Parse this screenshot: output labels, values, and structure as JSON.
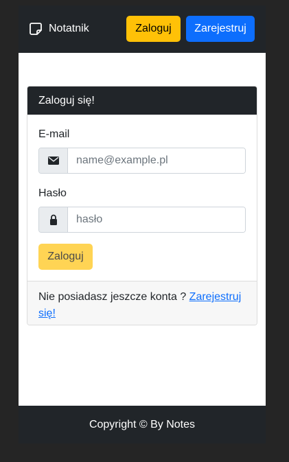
{
  "navbar": {
    "brand": {
      "icon": "note-icon",
      "label": "Notatnik"
    },
    "login_label": "Zaloguj",
    "register_label": "Zarejestruj"
  },
  "login_card": {
    "title": "Zaloguj się!",
    "email": {
      "label": "E-mail",
      "icon": "envelope-icon",
      "placeholder": "name@example.pl",
      "value": ""
    },
    "password": {
      "label": "Hasło",
      "icon": "lock-icon",
      "placeholder": "hasło",
      "value": ""
    },
    "submit_label": "Zaloguj",
    "footer_text": "Nie posiadasz jeszcze konta ? ",
    "footer_link": "Zarejestruj się!"
  },
  "footer": {
    "copyright": "Copyright © By Notes"
  },
  "colors": {
    "dark": "#212529",
    "warning": "#ffc107",
    "primary": "#0d6efd",
    "background": "#252525"
  }
}
